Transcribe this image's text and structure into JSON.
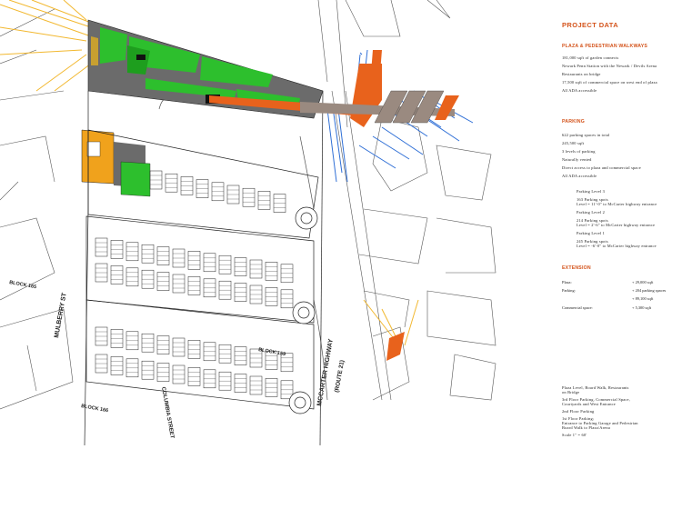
{
  "plan": {
    "street_labels": {
      "mulberry": "MULBERRY ST",
      "block_165": "BLOCK 165",
      "block_159": "BLOCK 159",
      "block_166": "BLOCK 166",
      "columbia": "COLUMBIA STREET",
      "mccarter": "MCCARTER HIGHWAY",
      "route": "(ROUTE 21)"
    },
    "colors": {
      "garden": "#2dbf2d",
      "deck": "#6b6b6b",
      "commercial": "#f0a21c",
      "bridge": "#e8621c",
      "walkway": "#9a8a80",
      "water_arrow": "#2f6fd6",
      "sun_ray": "#f2b830"
    }
  },
  "panel": {
    "title": "PROJECT DATA",
    "plaza": {
      "heading": "PLAZA & PEDESTRIAN WALKWAYS",
      "lines": [
        "181,000 sqft of garden connects",
        "Newark Penn Station with the Newark / Devils Arena",
        "Restaurants on bridge",
        "17,500 sqft of commercial space on west end of plaza",
        "All ADA accessible"
      ]
    },
    "parking": {
      "heading": "PARKING",
      "lines": [
        "622 parking spaces in total",
        "245,500 sqft",
        "3 levels of parking",
        "Naturally vented",
        "Direct access to plaza and commercial space",
        "All ADA accessible"
      ],
      "levels": [
        {
          "name": "Parking Level 3",
          "lines": [
            "163 Parking spots",
            "Level = 11'-0\" to McCarter highway entrance"
          ]
        },
        {
          "name": "Parking Level 2",
          "lines": [
            "214 Parking spots",
            "Level = 2'-6\" to McCarter highway entrance"
          ]
        },
        {
          "name": "Parking Level 1",
          "lines": [
            "245 Parking spots",
            "Level = -6'-0\" to McCarter highway entrance"
          ]
        }
      ]
    },
    "extension": {
      "heading": "EXTENSION",
      "rows": [
        {
          "label": "Plaza:",
          "value": "+ 29,000 sqft"
        },
        {
          "label": "Parking:",
          "value": "+ 204 parking spaces"
        },
        {
          "label": "",
          "value": "+ 89,100 sqft"
        },
        {
          "label": "Commercial space:",
          "value": "+ 5,300 sqft"
        }
      ]
    },
    "legend": [
      "Plaza Level, Board Walk, Restaurants",
      "on Bridge",
      "",
      "3rd Floor Parking, Commercial Space,",
      "Courtyards and West Entrance",
      "",
      "2nd Floor Parking",
      "",
      "1st Floor Parking;",
      "Entrance to Parking Garage and Pedestrian",
      "Board Walk to Plaza/Arena",
      "",
      "Scale 1\" = 60'"
    ]
  }
}
